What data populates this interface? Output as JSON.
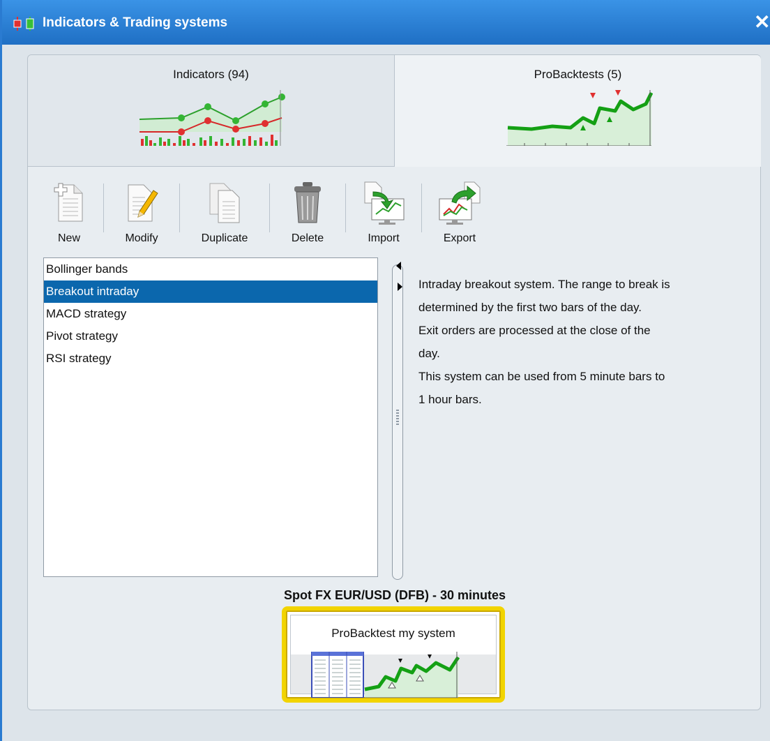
{
  "window": {
    "title": "Indicators & Trading systems",
    "close_glyph": "✕"
  },
  "tabs": [
    {
      "label": "Indicators (94)"
    },
    {
      "label": "ProBacktests (5)"
    }
  ],
  "toolbar": {
    "new_label": "New",
    "modify_label": "Modify",
    "duplicate_label": "Duplicate",
    "delete_label": "Delete",
    "import_label": "Import",
    "export_label": "Export"
  },
  "systems": {
    "items": [
      "Bollinger bands",
      "Breakout intraday",
      "MACD strategy",
      "Pivot strategy",
      "RSI strategy"
    ],
    "selected": "Breakout intraday"
  },
  "description": {
    "lines": [
      "Intraday breakout system. The range to break is",
      "determined by the first two bars of the day.",
      "Exit orders are processed at the close of the",
      "day.",
      "This system can be used from 5 minute bars to",
      "1 hour bars."
    ]
  },
  "footer": {
    "instrument": "Spot FX EUR/USD (DFB) - 30 minutes",
    "backtest_button_label": "ProBacktest my system"
  },
  "colors": {
    "title_bar": "#2a7bd1",
    "selection": "#0b67ad",
    "highlight_border": "#f2d400"
  }
}
